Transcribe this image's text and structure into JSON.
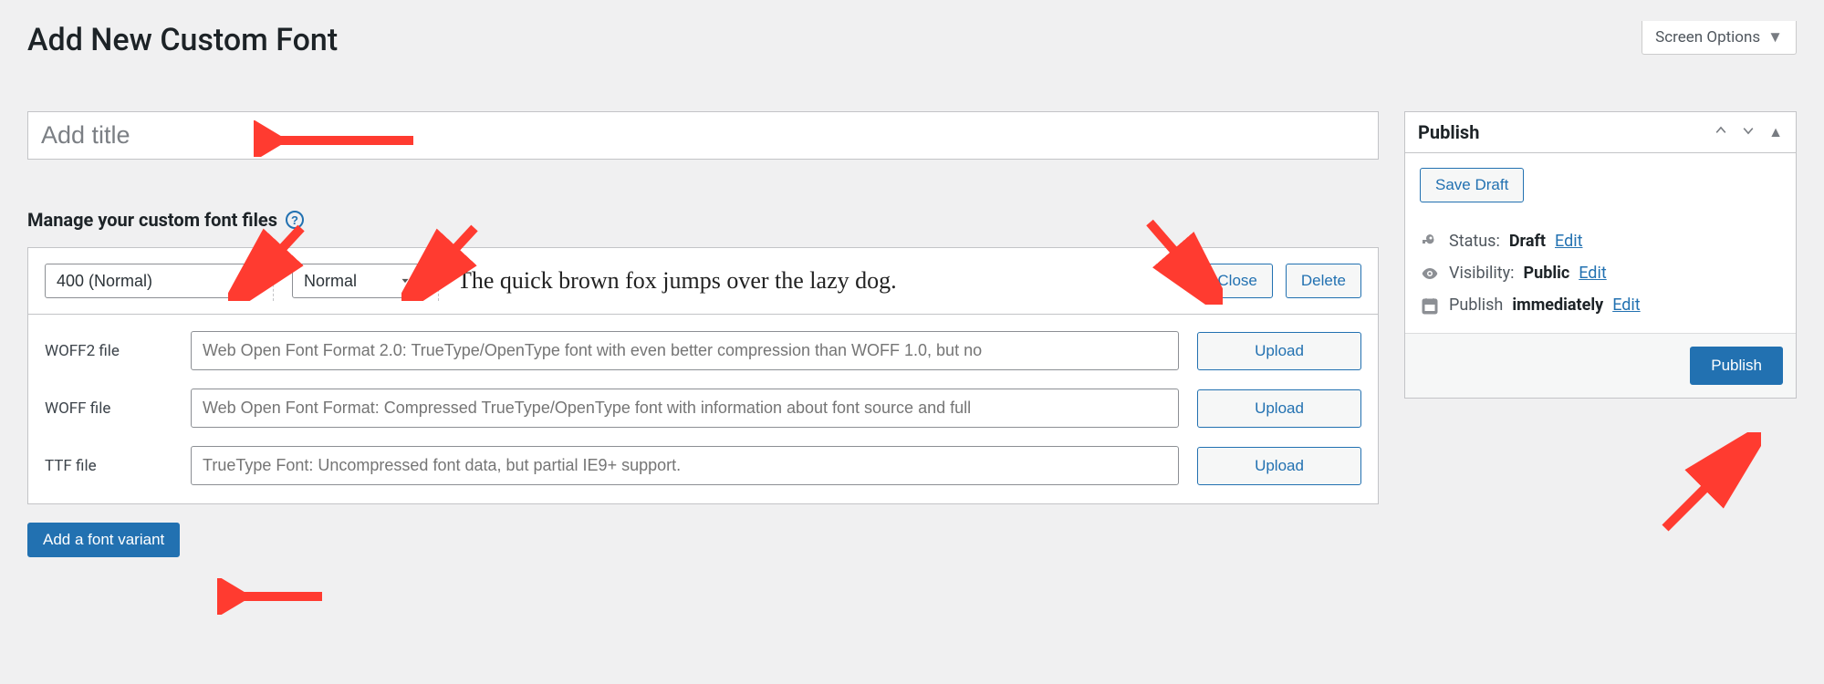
{
  "screen_options_label": "Screen Options",
  "page_title": "Add New Custom Font",
  "title_placeholder": "Add title",
  "manage_heading": "Manage your custom font files",
  "variant": {
    "weight_selected": "400 (Normal)",
    "style_selected": "Normal",
    "preview_text": "The quick brown fox jumps over the lazy dog.",
    "close_label": "Close",
    "delete_label": "Delete"
  },
  "file_rows": [
    {
      "label": "WOFF2 file",
      "placeholder": "Web Open Font Format 2.0: TrueType/OpenType font with even better compression than WOFF 1.0, but no"
    },
    {
      "label": "WOFF file",
      "placeholder": "Web Open Font Format: Compressed TrueType/OpenType font with information about font source and full"
    },
    {
      "label": "TTF file",
      "placeholder": "TrueType Font: Uncompressed font data, but partial IE9+ support."
    }
  ],
  "upload_label": "Upload",
  "add_variant_label": "Add a font variant",
  "publish_box": {
    "title": "Publish",
    "save_draft": "Save Draft",
    "status_label": "Status:",
    "status_value": "Draft",
    "visibility_label": "Visibility:",
    "visibility_value": "Public",
    "publish_label": "Publish",
    "publish_when": "immediately",
    "edit_label": "Edit",
    "publish_button": "Publish"
  }
}
